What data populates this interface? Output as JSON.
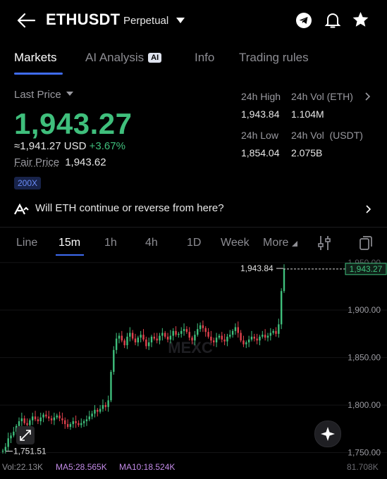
{
  "header": {
    "symbol": "ETHUSDT",
    "contract_type": "Perpetual",
    "icons": [
      "back-arrow-icon",
      "chevron-down-icon",
      "telegram-icon",
      "bell-icon",
      "star-icon"
    ]
  },
  "tabs": [
    {
      "label": "Markets",
      "active": true
    },
    {
      "label": "AI Analysis",
      "badge": "AI"
    },
    {
      "label": "Info"
    },
    {
      "label": "Trading rules"
    }
  ],
  "price": {
    "last_price_label": "Last Price",
    "last_price": "1,943.27",
    "approx": "≈1,941.27 USD",
    "change": "+3.67%",
    "fair_price_label": "Fair Price",
    "fair_price": "1,943.62",
    "leverage": "200X",
    "up_color": "#3fbf7c"
  },
  "stats": {
    "high_label": "24h High",
    "high": "1,943.84",
    "vol_eth_label": "24h Vol (ETH)",
    "vol_eth": "1.104M",
    "low_label": "24h Low",
    "low": "1,854.04",
    "vol_usdt_label": "24h Vol  (USDT)",
    "vol_usdt": "2.075B"
  },
  "ai_question": "Will ETH continue or reverse from here?",
  "intervals": [
    {
      "label": "Line"
    },
    {
      "label": "15m",
      "active": true
    },
    {
      "label": "1h"
    },
    {
      "label": "4h"
    },
    {
      "label": "1D"
    },
    {
      "label": "Week"
    },
    {
      "label": "More"
    }
  ],
  "chart_data": {
    "type": "candlestick",
    "y_ticks": [
      "1,950.00",
      "1,900.00",
      "1,850.00",
      "1,800.00",
      "1,750.00"
    ],
    "ylim": [
      1740,
      1955
    ],
    "current_price_tag": "1,943.27",
    "high_label": "1,943.84",
    "low_label": "1,751.51",
    "watermark": "MEXC",
    "closes": [
      1752,
      1756,
      1765,
      1768,
      1772,
      1778,
      1783,
      1786,
      1781,
      1779,
      1784,
      1788,
      1785,
      1783,
      1787,
      1790,
      1788,
      1786,
      1784,
      1787,
      1789,
      1786,
      1784,
      1780,
      1777,
      1780,
      1783,
      1781,
      1779,
      1781,
      1783,
      1785,
      1788,
      1791,
      1795,
      1793,
      1796,
      1800,
      1798,
      1805,
      1835,
      1858,
      1870,
      1873,
      1868,
      1863,
      1872,
      1876,
      1870,
      1866,
      1871,
      1874,
      1869,
      1862,
      1866,
      1872,
      1870,
      1868,
      1873,
      1876,
      1872,
      1869,
      1873,
      1878,
      1874,
      1875,
      1878,
      1880,
      1877,
      1871,
      1868,
      1874,
      1880,
      1884,
      1881,
      1877,
      1872,
      1868,
      1866,
      1871,
      1873,
      1869,
      1867,
      1872,
      1874,
      1878,
      1882,
      1876,
      1868,
      1864,
      1866,
      1869,
      1872,
      1870,
      1868,
      1872,
      1874,
      1871,
      1873,
      1876,
      1878,
      1875,
      1885,
      1920,
      1943.27
    ]
  },
  "volume": {
    "vol": "Vol:22.13K",
    "ma5": "MA5:28.565K",
    "ma10": "MA10:18.524K",
    "max": "81.708K",
    "ma5_color": "#c38be8",
    "ma10_color": "#c38be8"
  }
}
